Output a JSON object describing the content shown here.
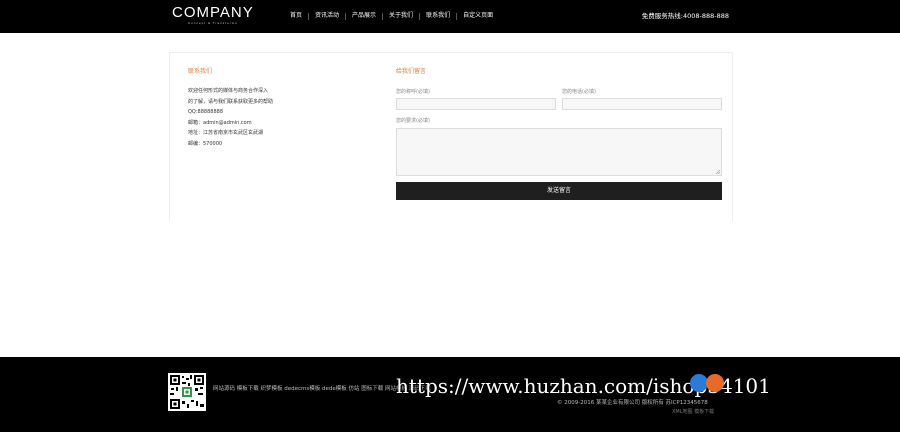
{
  "header": {
    "logo": "COMPANY",
    "logo_sub": "Concept & Transforms",
    "nav": [
      "首页",
      "资讯活动",
      "产品展示",
      "关于我们",
      "联系我们",
      "自定义页面"
    ],
    "hotline": "免费服务热线:4008-888-888"
  },
  "contact": {
    "title": "联系我们",
    "lines": [
      "欢迎任何形式的媒体与商务合作深入",
      "的了解，请与我们联系获取更多的帮助",
      "QQ:88888888",
      "邮箱：admin@admin.com",
      "地址：江苏省南京市玄武区玄武湖",
      "邮编：570000"
    ]
  },
  "form": {
    "title": "给我们留言",
    "name_label": "您的称呼(必填)",
    "phone_label": "您的电话(必填)",
    "message_label": "您的要求(必填)",
    "submit_label": "发送留言"
  },
  "footer": {
    "links": "网站源码 模板下载 织梦模板 dedecms模板 dede模板 仿站 图标下载 网站模板 源码下载",
    "copyright": "© 2009-2016 某某企业有限公司 版权所有   苏ICP12345678",
    "sub_links": "XML地图   模板下载",
    "watermark": "https://www.huzhan.com/ishop34101"
  }
}
